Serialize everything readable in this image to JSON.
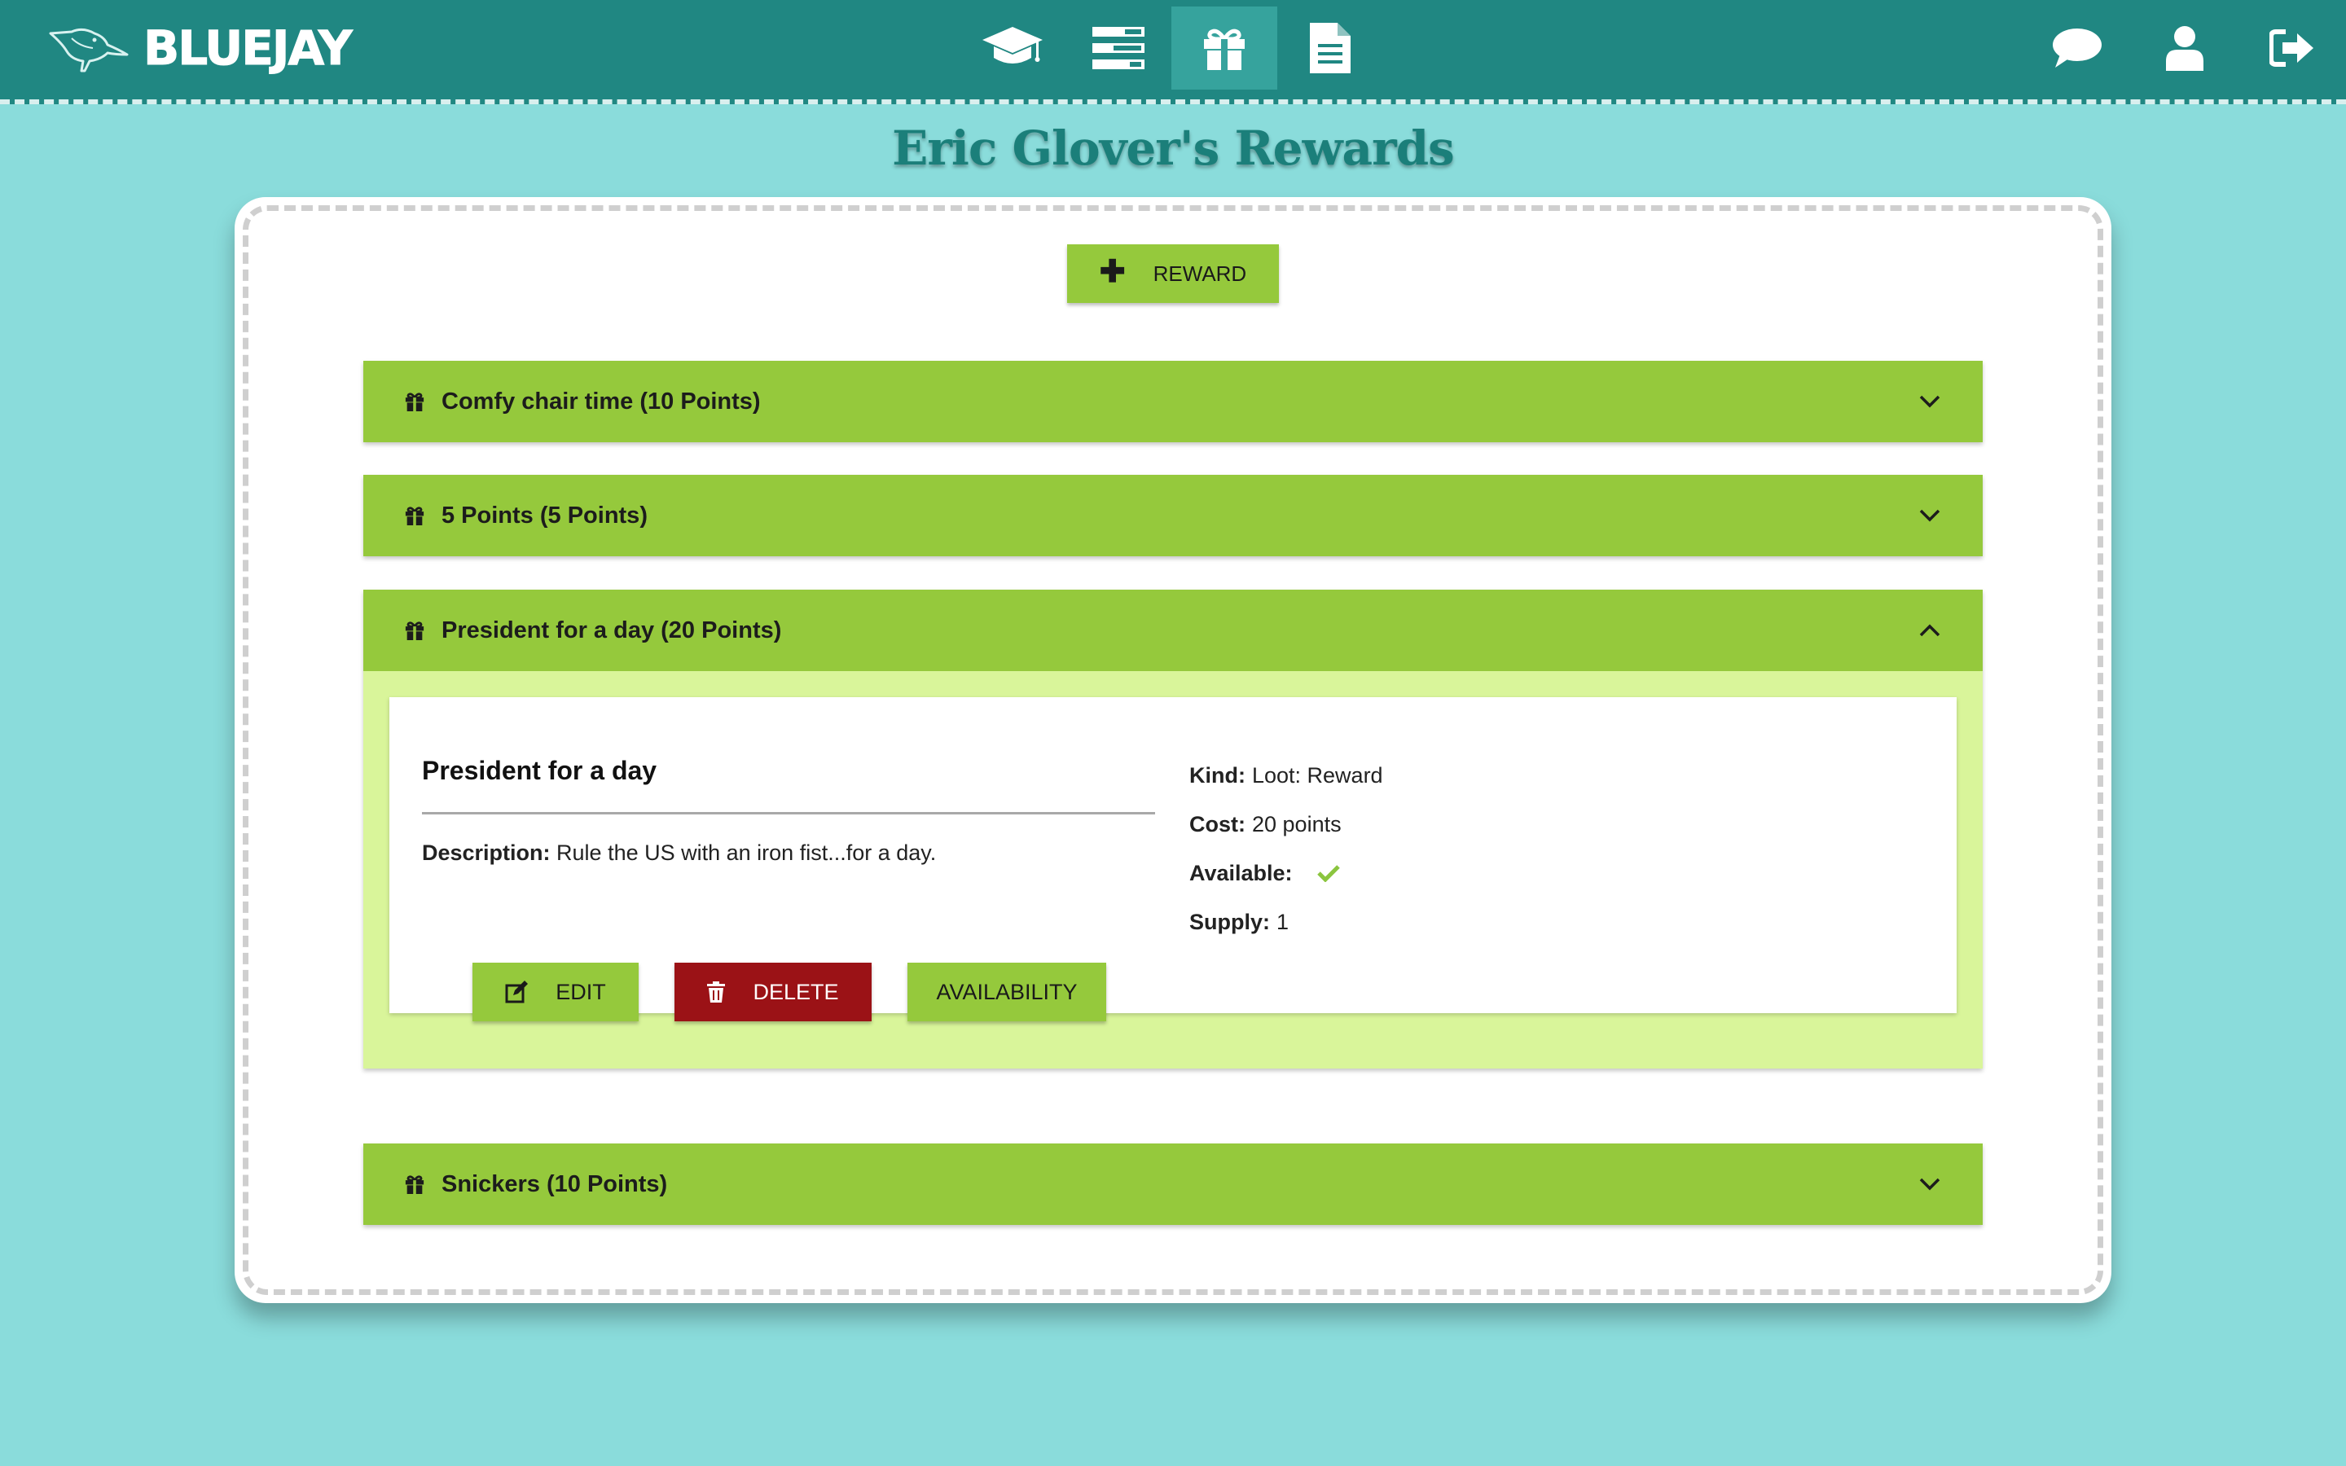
{
  "app": {
    "logo_text": "BLUEJAY"
  },
  "nav": {
    "center": [
      {
        "icon": "graduation-cap-icon",
        "label": "Classes",
        "active": false
      },
      {
        "icon": "tasks-list-icon",
        "label": "Tasks",
        "active": false
      },
      {
        "icon": "gift-icon",
        "label": "Rewards",
        "active": true
      },
      {
        "icon": "document-icon",
        "label": "Reports",
        "active": false
      }
    ],
    "right": [
      {
        "icon": "chat-bubble-icon",
        "label": "Messages"
      },
      {
        "icon": "user-icon",
        "label": "Profile"
      },
      {
        "icon": "sign-out-icon",
        "label": "Sign out"
      }
    ]
  },
  "page": {
    "title": "Eric Glover's Rewards",
    "add_button_label": "REWARD"
  },
  "rewards": [
    {
      "title": "Comfy chair time (10 Points)",
      "expanded": false
    },
    {
      "title": "5 Points (5 Points)",
      "expanded": false
    },
    {
      "title": "President for a day (20 Points)",
      "expanded": true
    },
    {
      "title": "Snickers (10 Points)",
      "expanded": false
    }
  ],
  "detail": {
    "name": "President for a day",
    "description_label": "Description:",
    "description": "Rule the US with an iron fist...for a day.",
    "kind_label": "Kind:",
    "kind": "Loot: Reward",
    "cost_label": "Cost:",
    "cost": "20 points",
    "available_label": "Available:",
    "available": true,
    "supply_label": "Supply:",
    "supply": "1",
    "edit_label": "EDIT",
    "delete_label": "DELETE",
    "availability_label": "AVAILABILITY"
  },
  "colors": {
    "nav_bg": "#208782",
    "page_bg": "#8adcdb",
    "accent_green": "#95c93c",
    "light_green": "#d9f59a",
    "danger": "#9b1216",
    "title": "#1b7f7a"
  }
}
